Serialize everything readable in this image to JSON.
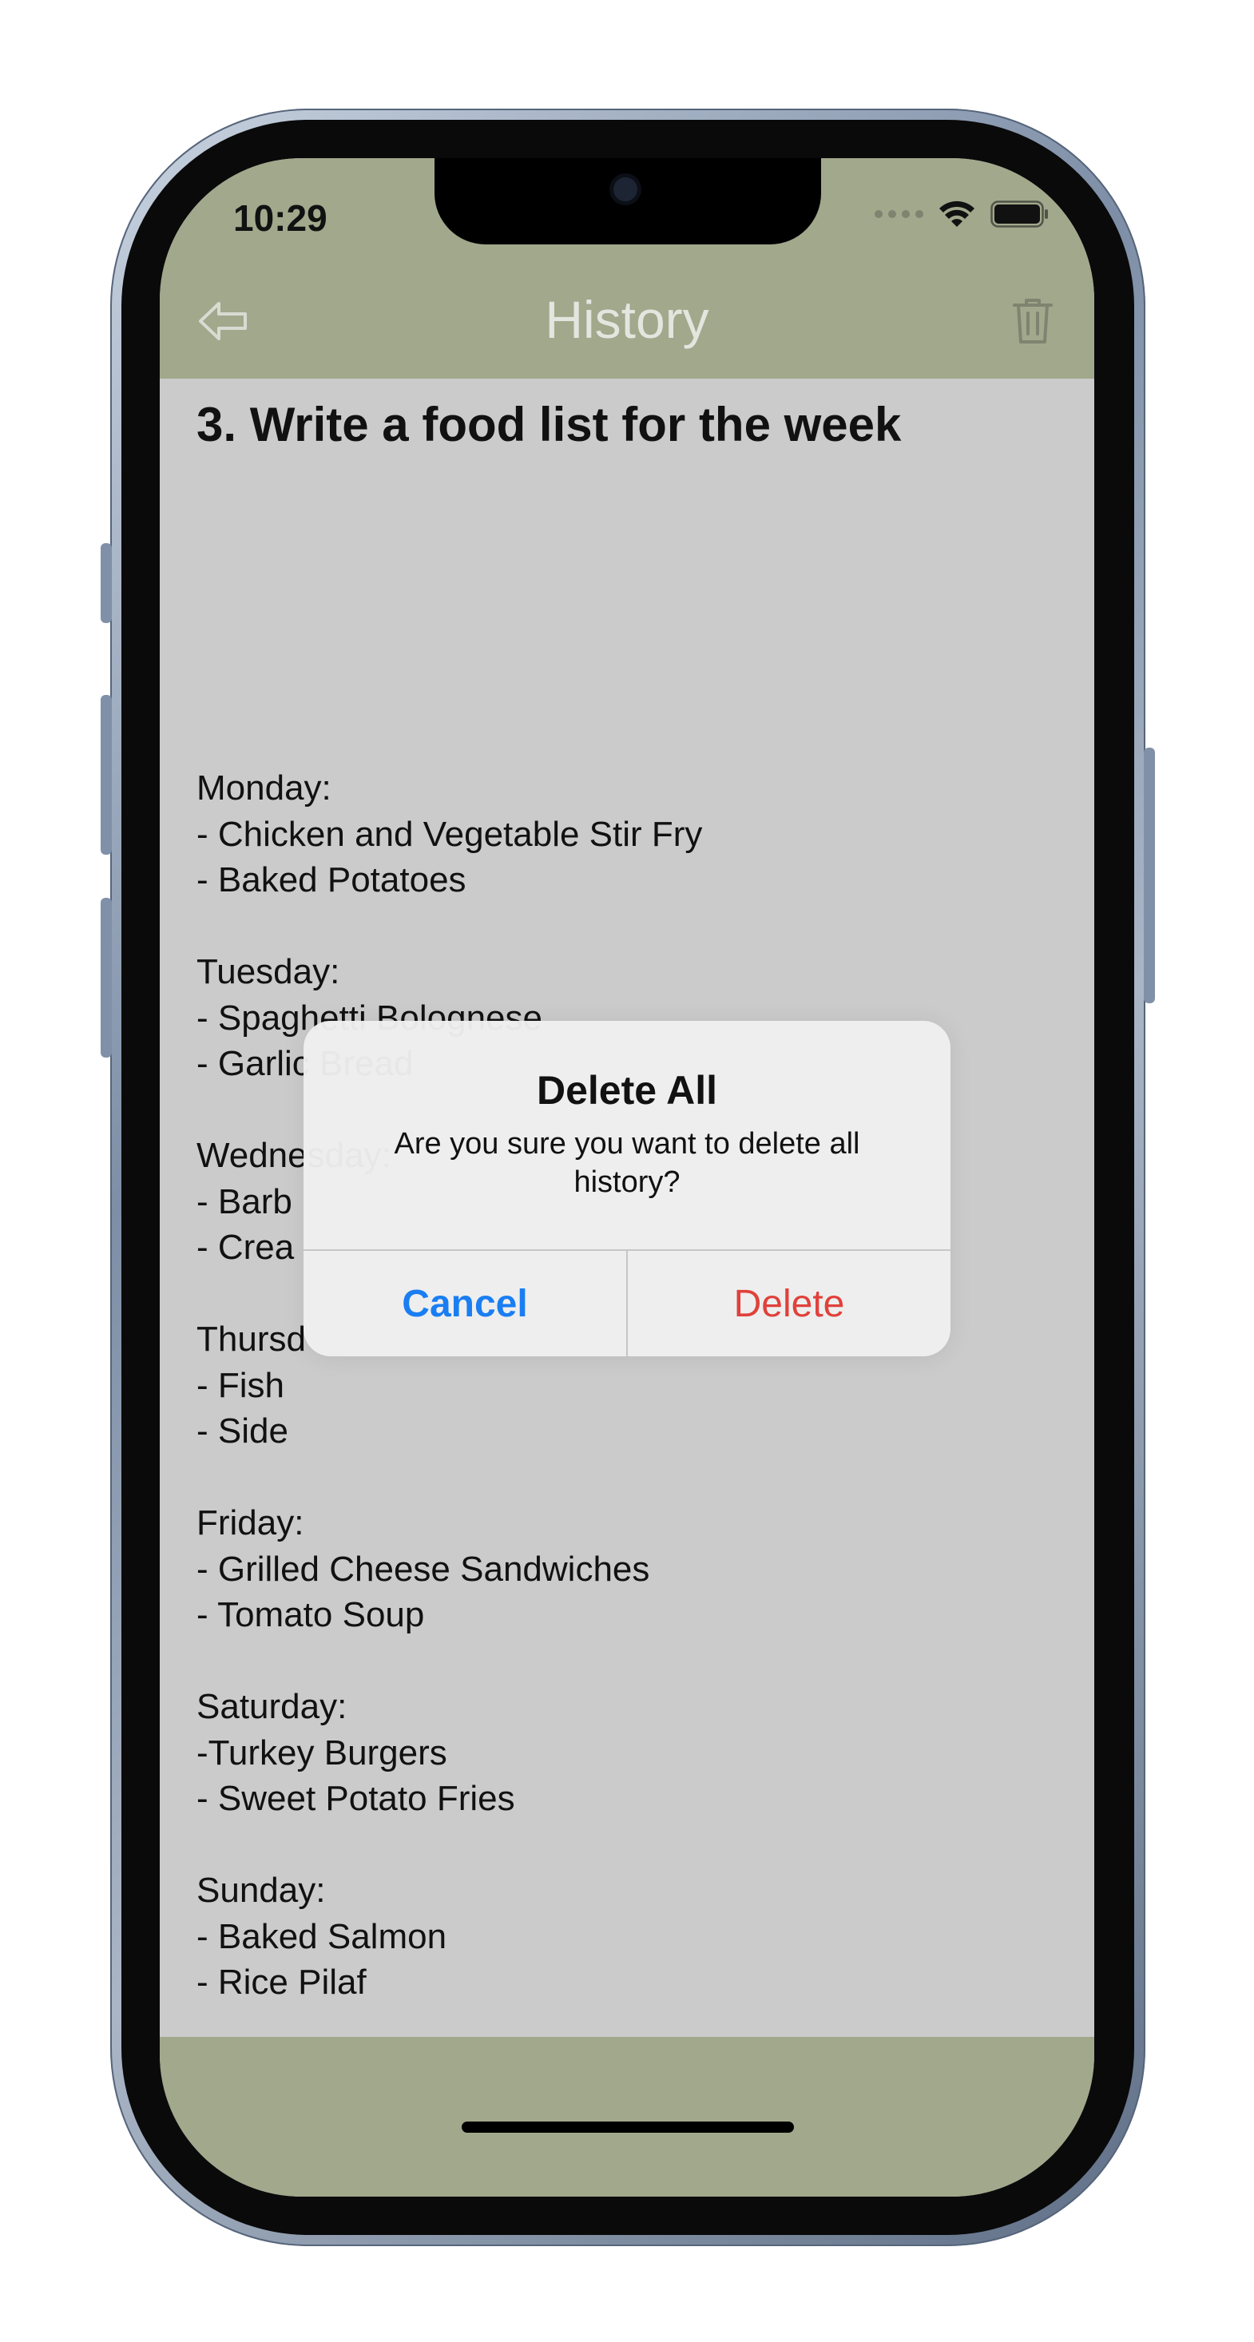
{
  "status_bar": {
    "time": "10:29"
  },
  "nav": {
    "title": "History",
    "back_icon": "back-arrow-icon",
    "trash_icon": "trash-icon"
  },
  "content": {
    "title": "3. Write a food list for the week",
    "body": "Monday:\n- Chicken and Vegetable Stir Fry\n- Baked Potatoes\n\nTuesday:\n- Spaghetti Bolognese\n- Garlic Bread\n\nWednesday:\n- Barb\n- Crea\n\nThursd\n- Fish\n- Side\n\nFriday:\n- Grilled Cheese Sandwiches\n- Tomato Soup\n\nSaturday:\n-Turkey Burgers\n- Sweet Potato Fries\n\nSunday:\n- Baked Salmon\n- Rice Pilaf"
  },
  "alert": {
    "title": "Delete All",
    "message": "Are you sure you want to delete all history?",
    "cancel_label": "Cancel",
    "delete_label": "Delete"
  },
  "colors": {
    "header_bg": "#a1a88c",
    "content_bg": "#cbcbcb",
    "cancel": "#1a7ef2",
    "delete": "#e0413a"
  }
}
